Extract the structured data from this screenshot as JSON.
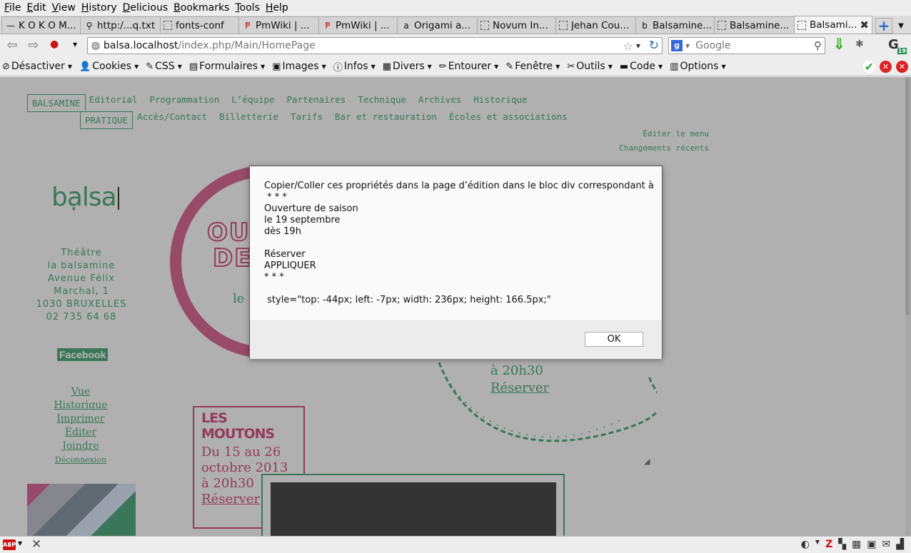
{
  "menubar": {
    "items": [
      "File",
      "Edit",
      "View",
      "History",
      "Delicious",
      "Bookmarks",
      "Tools",
      "Help"
    ]
  },
  "tabs": [
    {
      "title": "K O K O M...",
      "icon": "dash"
    },
    {
      "title": "http:/...q.txt",
      "icon": "share"
    },
    {
      "title": "fonts-conf",
      "icon": "blank"
    },
    {
      "title": "PmWiki | ...",
      "icon": "pmwiki"
    },
    {
      "title": "PmWiki | ...",
      "icon": "pmwiki"
    },
    {
      "title": "Origami a...",
      "icon": "amazon"
    },
    {
      "title": "Novum In...",
      "icon": "blank"
    },
    {
      "title": "Jehan Cou...",
      "icon": "blank"
    },
    {
      "title": "Balsamine...",
      "icon": "b"
    },
    {
      "title": "Balsamine...",
      "icon": "blank"
    },
    {
      "title": "Balsami...",
      "icon": "blank",
      "active": true
    }
  ],
  "navbar": {
    "url_host": "balsa.localhost",
    "url_path": "/index.php/Main/HomePage",
    "search_placeholder": "Google",
    "badge_count": "19"
  },
  "devbar": {
    "items": [
      {
        "label": "Désactiver",
        "icon": "⊘"
      },
      {
        "label": "Cookies",
        "icon": "👤"
      },
      {
        "label": "CSS",
        "icon": "✎"
      },
      {
        "label": "Formulaires",
        "icon": "▤"
      },
      {
        "label": "Images",
        "icon": "▣"
      },
      {
        "label": "Infos",
        "icon": "ⓘ"
      },
      {
        "label": "Divers",
        "icon": "▦"
      },
      {
        "label": "Entourer",
        "icon": "✏"
      },
      {
        "label": "Fenêtre",
        "icon": "✎"
      },
      {
        "label": "Outils",
        "icon": "✂"
      },
      {
        "label": "Code",
        "icon": "▬"
      },
      {
        "label": "Options",
        "icon": "▥"
      }
    ]
  },
  "site": {
    "nav1": [
      "BALSAMINE",
      "Editorial",
      "Programmation",
      "L’équipe",
      "Partenaires",
      "Technique",
      "Archives",
      "Historique"
    ],
    "nav2": [
      "PRATIQUE",
      "Accès/Contact",
      "Billetterie",
      "Tarifs",
      "Bar et restauration",
      "Écoles et associations"
    ],
    "edit_menu": "Éditer le menu",
    "recent_changes": "Changements récents",
    "logo": "bạlsa",
    "address": [
      "Théâtre",
      "la balsamine",
      "Avenue Félix",
      "Marchal, 1",
      "1030 BRUXELLES",
      "02 735 64 68"
    ],
    "facebook": "Facebook",
    "sidelinks": [
      "Vue",
      "Historique",
      "Imprimer",
      "Éditer",
      "Joindre"
    ],
    "logout": "Déconnexion",
    "hero_line1": "OUV",
    "hero_line2": "DE",
    "hero_le": "le",
    "green_time": "à 20h30",
    "green_reserve": "Réserver",
    "moutons_title": "LES MOUTONS",
    "moutons_date1": "Du 15 au 26",
    "moutons_date2": "octobre 2013",
    "moutons_time": "à 20h30",
    "moutons_reserve": "Réserver"
  },
  "dialog": {
    "message": "Copier/Coller ces propriétés dans la page d’édition dans le bloc div correspondant à\n * * *\nOuverture de saison\nle 19 septembre\ndès 19h\n\nRéserver\nAPPLIQUER\n* * *\n\n style=\"top: -44px; left: -7px; width: 236px; height: 166.5px;\"",
    "ok_label": "OK"
  },
  "colors": {
    "green": "#1f8f5a",
    "pink": "#c21f5b"
  }
}
